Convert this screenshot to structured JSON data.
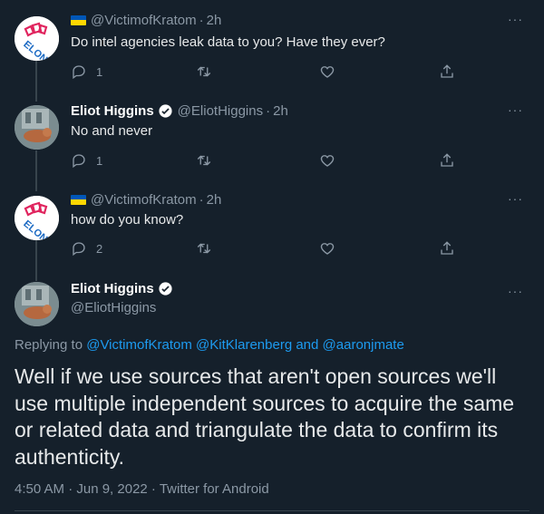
{
  "tweets": [
    {
      "author_handle": "@VictimofKratom",
      "flag": "ukraine-flag",
      "time": "2h",
      "text": "Do intel agencies leak data to you? Have they ever?",
      "replies": "1",
      "retweets": "",
      "likes": ""
    },
    {
      "author_name": "Eliot Higgins",
      "author_handle": "@EliotHiggins",
      "time": "2h",
      "text": "No and never",
      "replies": "1",
      "retweets": "",
      "likes": ""
    },
    {
      "author_handle": "@VictimofKratom",
      "flag": "ukraine-flag",
      "time": "2h",
      "text": "how do you know?",
      "replies": "2",
      "retweets": "",
      "likes": ""
    }
  ],
  "main_tweet": {
    "author_name": "Eliot Higgins",
    "author_handle": "@EliotHiggins",
    "replying_prefix": "Replying to ",
    "replying_to_1": "@VictimofKratom",
    "replying_to_2": "@KitKlarenberg",
    "replying_and": " and ",
    "replying_to_3": "@aaronjmate",
    "body_line_1": "Well if we use sources that aren't open sources we'll",
    "body_line_2": "use multiple independent sources to acquire the same",
    "body_line_3": "or related data and triangulate the data to confirm its",
    "body_line_4": "authenticity.",
    "timestamp": "4:50 AM · Jun 9, 2022 · ",
    "client": "Twitter for Android"
  },
  "separator": "·",
  "more_glyph": "···",
  "colors": {
    "background": "#15202b",
    "accent": "#1d9bf0",
    "muted": "#8b98a5",
    "flag_blue": "#0057b7",
    "flag_yellow": "#ffd700"
  }
}
